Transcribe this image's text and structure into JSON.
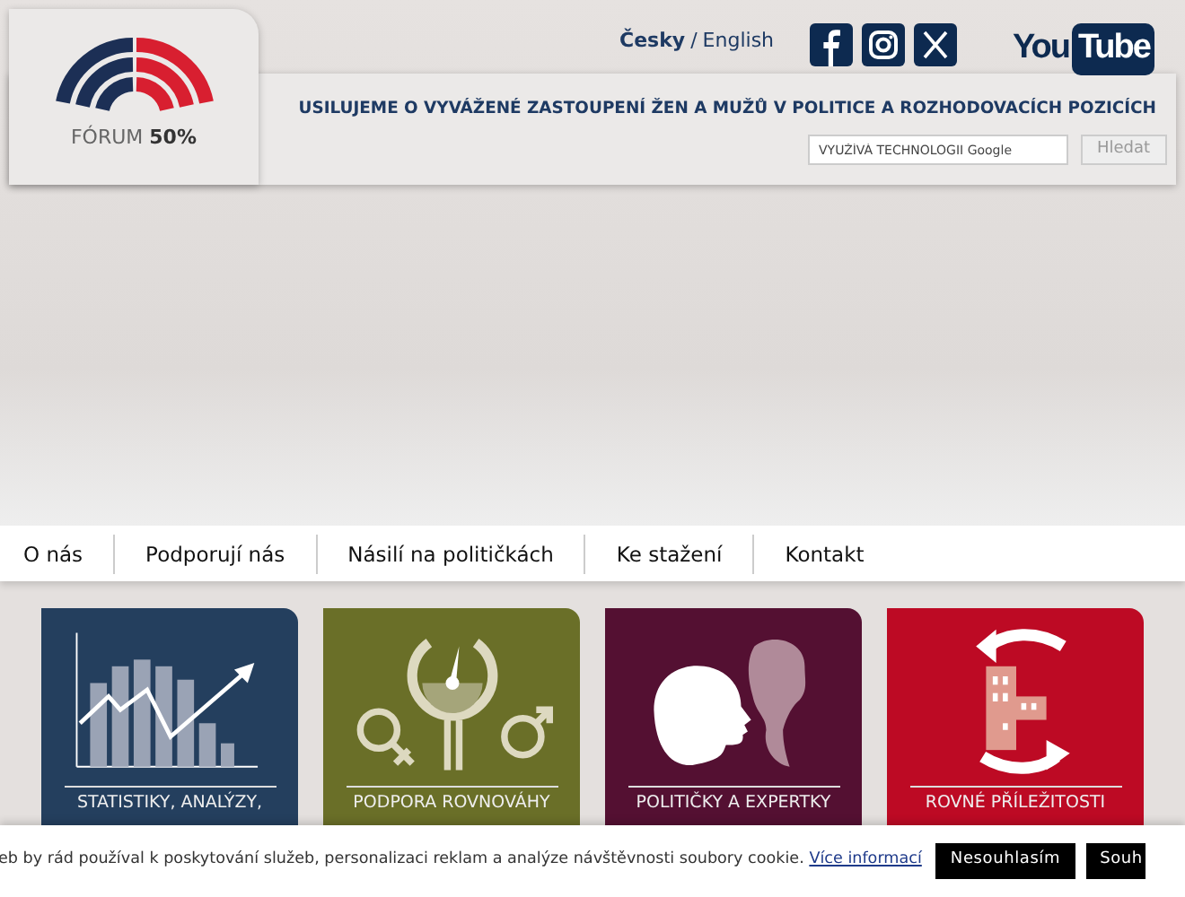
{
  "header": {
    "logo_text": "FÓRUM",
    "logo_bold": "50%",
    "language_separator": "/",
    "languages": [
      {
        "label": "Česky",
        "selected": true
      },
      {
        "label": "English",
        "selected": false
      }
    ],
    "youtube": [
      "You",
      "Tube"
    ],
    "tagline": "USILUJEME O VYVÁŽENÉ ZASTOUPENÍ ŽEN A MUŽŮ V POLITICE A ROZHODOVACÍCH POZICÍCH"
  },
  "search": {
    "placeholder": "VYUŽÍVÁ TECHNOLOGII Google",
    "button": "Hledat"
  },
  "nav": [
    "O nás",
    "Podporují nás",
    "Násilí na političkách",
    "Ke stažení",
    "Kontakt"
  ],
  "tiles": [
    {
      "kind": "chart",
      "title": "STATISTIKY, ANALÝZY,",
      "color": "#243f5e"
    },
    {
      "kind": "balance",
      "title": "PODPORA ROVNOVÁHY",
      "color": "#6a6f28"
    },
    {
      "kind": "faces",
      "title": "POLITIČKY A EXPERTKY",
      "color": "#541032"
    },
    {
      "kind": "building",
      "title": "ROVNÉ PŘÍLEŽITOSTI",
      "color": "#bd0a24"
    }
  ],
  "cookie": {
    "text": "eb by rád používal k poskytování služeb, personalizaci reklam a analýze návštěvnosti soubory cookie.",
    "link": "Více informací",
    "buttons": [
      "Nesouhlasím",
      "Souh"
    ]
  }
}
